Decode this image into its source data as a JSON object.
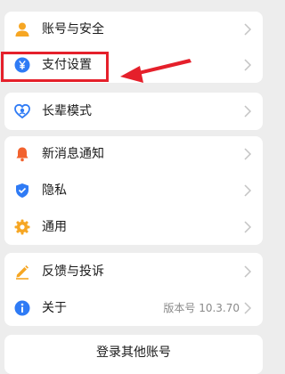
{
  "settings": {
    "account_security": "账号与安全",
    "payment_settings": "支付设置",
    "elder_mode": "长辈模式",
    "new_message_notice": "新消息通知",
    "privacy": "隐私",
    "general": "通用",
    "feedback": "反馈与投诉",
    "about": "关于",
    "version_text": "版本号 10.3.70",
    "switch_account": "登录其他账号"
  },
  "icons": {
    "account": "person-icon",
    "payment": "yuan-icon",
    "elder": "heart-icon",
    "notice": "bell-icon",
    "privacy": "shield-icon",
    "general": "gear-icon",
    "feedback": "pen-icon",
    "about": "info-icon"
  },
  "colors": {
    "background": "#ededed",
    "highlight": "#e5202b",
    "orange": "#f6a623",
    "blue": "#2f7bf5"
  }
}
